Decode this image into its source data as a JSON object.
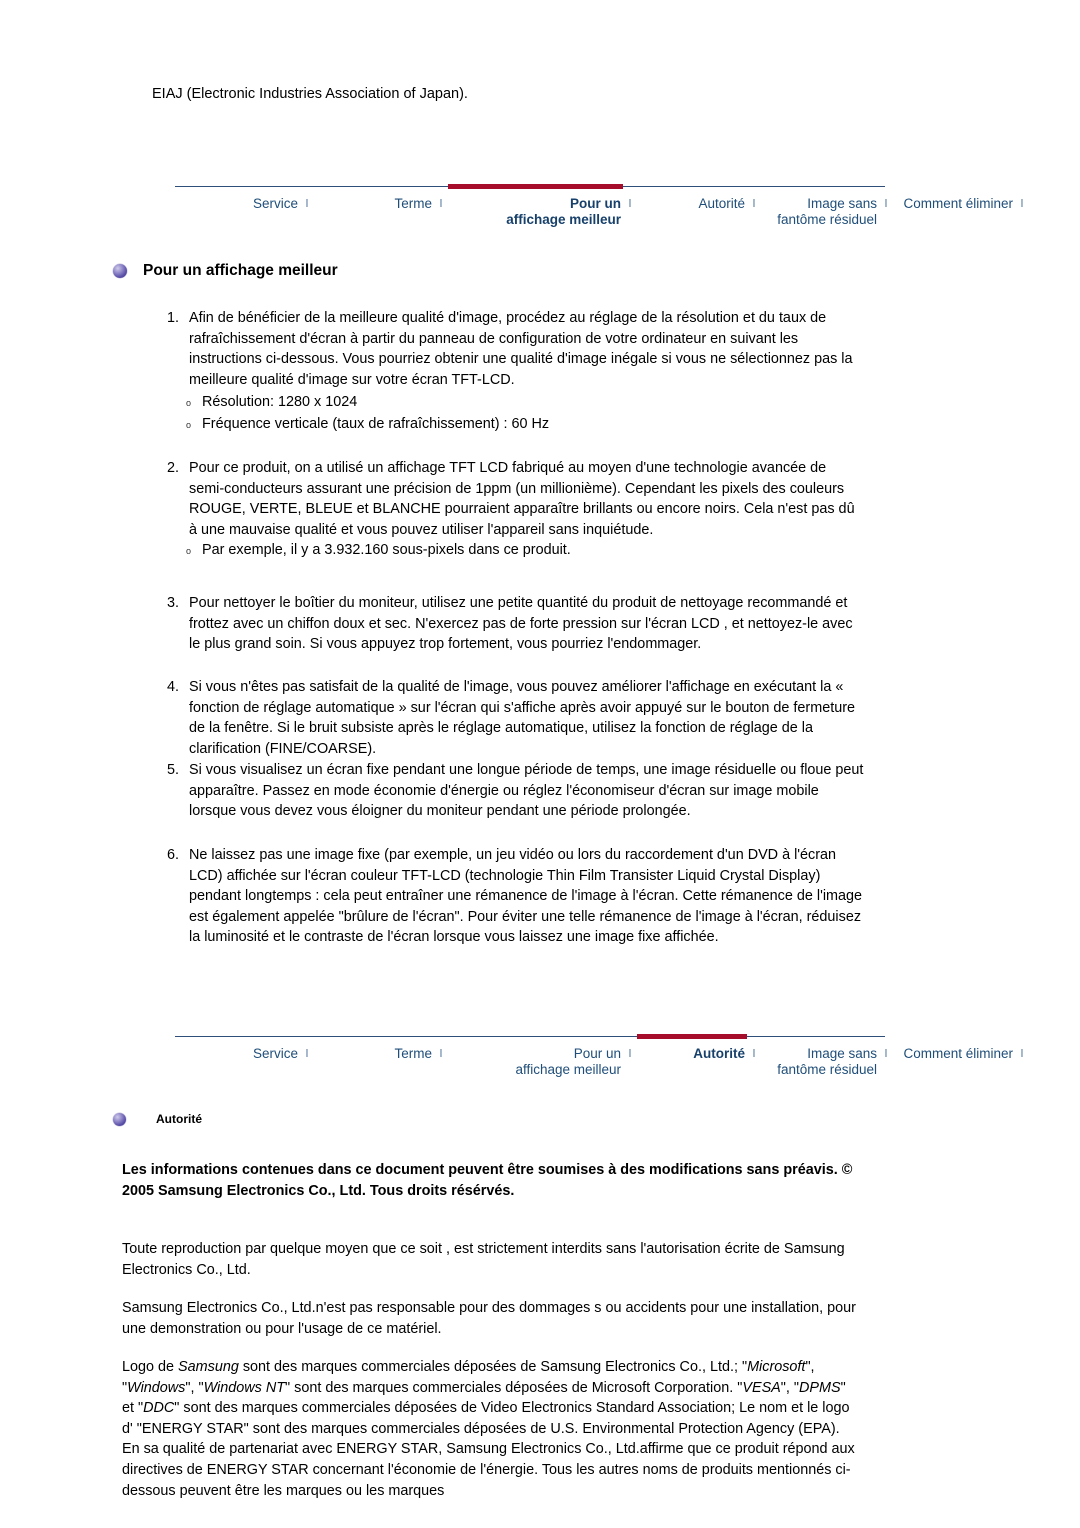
{
  "intro": {
    "line": "EIAJ (Electronic Industries Association of Japan)."
  },
  "nav_top": {
    "items": [
      {
        "label": "Service",
        "active": false
      },
      {
        "label": "Terme",
        "active": false
      },
      {
        "label": "Pour un",
        "label2": "affichage meilleur",
        "active": true
      },
      {
        "label": "Autorité",
        "active": false
      },
      {
        "label": "Image sans",
        "label2": "fantôme résiduel",
        "active": false
      },
      {
        "label": "Comment éliminer",
        "active": false
      }
    ],
    "separator": "l"
  },
  "nav_bottom": {
    "items": [
      {
        "label": "Service",
        "active": false
      },
      {
        "label": "Terme",
        "active": false
      },
      {
        "label": "Pour un",
        "label2": "affichage meilleur",
        "active": false
      },
      {
        "label": "Autorité",
        "active": true
      },
      {
        "label": "Image sans",
        "label2": "fantôme résiduel",
        "active": false
      },
      {
        "label": "Comment éliminer",
        "active": false
      }
    ],
    "separator": "l"
  },
  "section_display": {
    "heading": "Pour un affichage meilleur",
    "items": [
      {
        "num": "1.",
        "text": "Afin de bénéficier de la meilleure qualité d'image, procédez au réglage de la résolution et du taux de rafraîchissement d'écran à partir du panneau de configuration de votre ordinateur en suivant les instructions ci-dessous. Vous pourriez obtenir une qualité d'image inégale si vous ne sélectionnez pas la meilleure qualité d'image sur votre écran TFT-LCD."
      },
      {
        "num": "2.",
        "text": "Pour ce produit, on a utilisé un affichage TFT LCD fabriqué au moyen d'une technologie avancée de semi-conducteurs assurant une précision de 1ppm (un millionième). Cependant les pixels des couleurs ROUGE, VERTE, BLEUE et BLANCHE pourraient apparaître brillants ou encore noirs. Cela n'est pas dû à une mauvaise qualité et vous pouvez utiliser l'appareil sans inquiétude."
      },
      {
        "num": "3.",
        "text": "Pour nettoyer le boîtier du moniteur, utilisez une petite quantité du produit de nettoyage recommandé et frottez avec un chiffon doux et sec. N'exercez pas de forte pression sur l'écran LCD , et nettoyez-le avec le plus grand soin. Si vous appuyez trop fortement, vous pourriez l'endommager."
      },
      {
        "num": "4.",
        "text": "Si vous n'êtes pas satisfait de la qualité de l'image, vous pouvez améliorer l'affichage en exécutant la « fonction de réglage automatique » sur l'écran qui s'affiche après avoir appuyé sur le bouton de fermeture de la fenêtre. Si le bruit subsiste après le réglage automatique, utilisez la fonction de réglage de la clarification (FINE/COARSE)."
      },
      {
        "num": "5.",
        "text": "Si vous visualisez un écran fixe pendant une longue période de temps, une image résiduelle ou floue peut apparaître. Passez en mode économie d'énergie ou réglez l'économiseur d'écran sur image mobile lorsque vous devez vous éloigner du moniteur pendant une période prolongée."
      },
      {
        "num": "6.",
        "text": "Ne laissez pas une image fixe (par exemple, un jeu vidéo ou lors du raccordement d'un DVD à l'écran LCD) affichée sur l'écran couleur TFT-LCD (technologie Thin Film Transister Liquid Crystal Display) pendant longtemps : cela peut entraîner une rémanence de l'image à l'écran. Cette rémanence de l'image est également appelée \"brûlure de l'écran\". Pour éviter une telle rémanence de l'image à l'écran, réduisez la luminosité et le contraste de l'écran lorsque vous laissez une image fixe affichée."
      }
    ],
    "sub_after_1": [
      "Résolution: 1280 x 1024",
      "Fréquence verticale (taux de rafraîchissement) : 60 Hz"
    ],
    "sub_after_2": [
      "Par exemple, il y a 3.932.160 sous-pixels dans ce produit."
    ],
    "sub_marker": "o"
  },
  "section_authority": {
    "heading": "Autorité",
    "copyright_bold": "Les informations contenues dans ce document peuvent être soumises à des modifications sans préavis. © 2005 Samsung Electronics Co., Ltd. Tous droits résérvés.",
    "para_reproduction": "Toute reproduction par quelque moyen que ce soit , est strictement interdits sans l'autorisation écrite de Samsung Electronics Co., Ltd.",
    "para_liability": "Samsung Electronics Co., Ltd.n'est pas responsable pour des dommages s ou accidents pour une installation, pour une demonstration ou pour l'usage de ce matériel.",
    "trademark": {
      "t1": "Logo de ",
      "i1": "Samsung",
      "t2": " sont des marques commerciales déposées de Samsung Electronics Co., Ltd.; \"",
      "i2": "Microsoft",
      "t3": "\", \"",
      "i3": "Windows",
      "t4": "\", \"",
      "i4": "Windows NT",
      "t5": "\" sont des marques commerciales déposées de Microsoft Corporation. \"",
      "i5": "VESA",
      "t6": "\", \"",
      "i6": "DPMS",
      "t7": "\" et \"",
      "i7": "DDC",
      "t8": "\" sont des marques commerciales déposées de Video Electronics Standard Association; Le nom et le logo d' \"ENERGY STAR\" sont des marques commerciales déposées de U.S. Environmental Protection Agency (EPA). En sa qualité de partenariat avec ENERGY STAR, Samsung Electronics Co., Ltd.affirme que ce produit répond aux directives de ENERGY STAR concernant l'économie de l'énergie. Tous les autres noms de produits mentionnés ci-dessous peuvent être les marques ou les marques"
    }
  },
  "colors": {
    "nav_link": "#1f4e79",
    "nav_active_bar": "#a50d2a",
    "rule": "#2e4f7a",
    "bullet": "#5b50a8"
  }
}
